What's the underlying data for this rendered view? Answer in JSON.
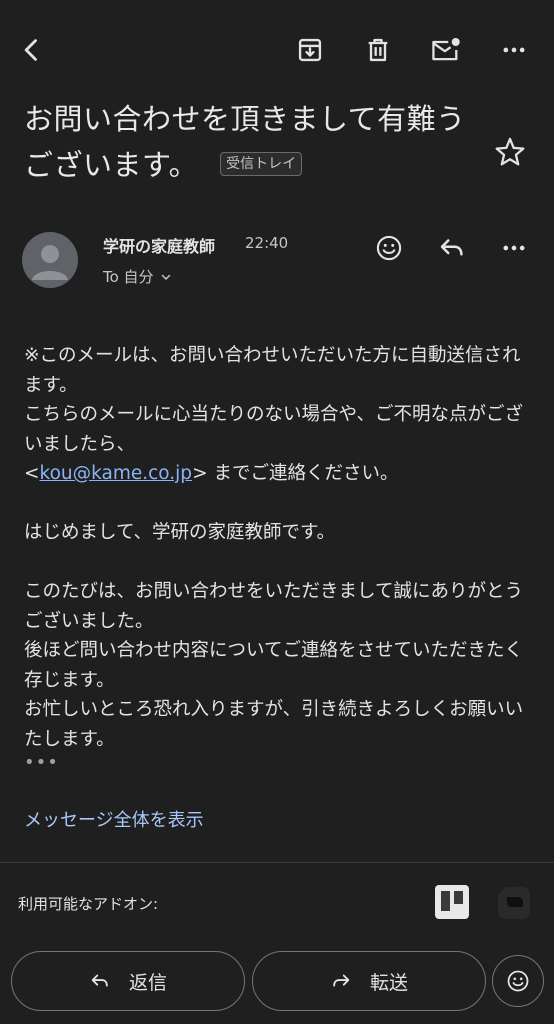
{
  "header": {
    "subject": "お問い合わせを頂きまして有難うございます。",
    "label": "受信トレイ"
  },
  "message": {
    "sender": "学研の家庭教師",
    "time": "22:40",
    "to": "To 自分",
    "body": {
      "line1": "※このメールは、お問い合わせいただいた方に自動送信されます。",
      "line2": "こちらのメールに心当たりのない場合や、ご不明な点がございましたら、",
      "link_prefix": "<",
      "email": "kou@kame.co.jp",
      "link_suffix": "> までご連絡ください。",
      "para2": "はじめまして、学研の家庭教師です。",
      "para3_line1": "このたびは、お問い合わせをいただきまして誠にありがとうございました。",
      "para3_line2": "後ほど問い合わせ内容についてご連絡をさせていただきたく存じます。",
      "para3_line3": "お忙しいところ恐れ入りますが、引き続きよろしくお願いいたします。"
    },
    "trimmed_marker": "•••",
    "show_all": "メッセージ全体を表示"
  },
  "addons": {
    "label": "利用可能なアドオン:",
    "items": [
      "trello-icon",
      "addon-icon"
    ]
  },
  "actions": {
    "reply": "返信",
    "forward": "転送"
  },
  "icons": {
    "back": "arrow-back-icon",
    "archive": "archive-icon",
    "delete": "trash-icon",
    "unread": "mark-unread-icon",
    "more": "more-vert-icon",
    "star": "star-icon",
    "emoji": "emoji-icon",
    "reply": "reply-icon",
    "forward": "forward-icon"
  }
}
